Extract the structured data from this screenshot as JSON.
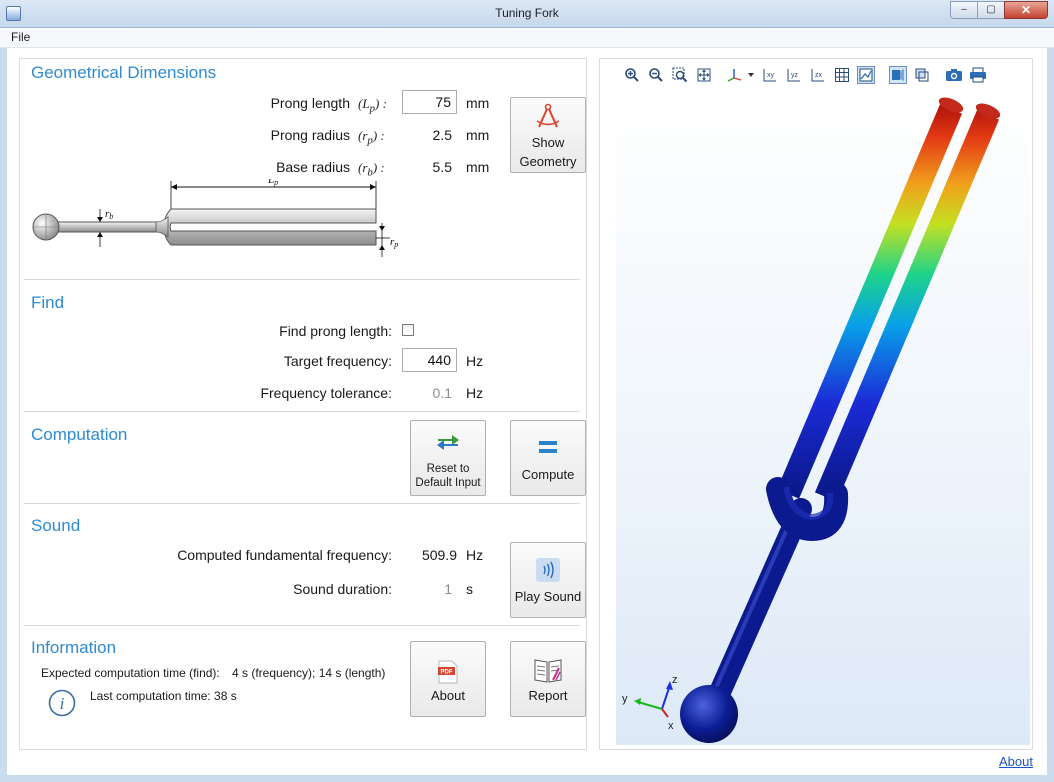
{
  "window": {
    "title": "Tuning Fork"
  },
  "window_controls": {
    "minimize": "–",
    "maximize": "▢",
    "close": "✕"
  },
  "menu": {
    "file": "File"
  },
  "geometry": {
    "title": "Geometrical Dimensions",
    "prong_length": {
      "label": "Prong length",
      "symbol": "(L",
      "sub": "p",
      "close": ") :",
      "value": "75",
      "unit": "mm"
    },
    "prong_radius": {
      "label": "Prong radius",
      "symbol": "(r",
      "sub": "p",
      "close": ") :",
      "value": "2.5",
      "unit": "mm"
    },
    "base_radius": {
      "label": "Base radius",
      "symbol": "(r",
      "sub": "b",
      "close": ") :",
      "value": "5.5",
      "unit": "mm"
    },
    "show_button": {
      "line1": "Show",
      "line2": "Geometry"
    },
    "sketch": {
      "lp": "L",
      "lp_sub": "p",
      "rb": "r",
      "rb_sub": "b",
      "rp": "r",
      "rp_sub": "p"
    }
  },
  "find": {
    "title": "Find",
    "find_prong_length": {
      "label": "Find prong length:",
      "checked": false
    },
    "target_frequency": {
      "label": "Target frequency:",
      "value": "440",
      "unit": "Hz"
    },
    "frequency_tolerance": {
      "label": "Frequency tolerance:",
      "value": "0.1",
      "unit": "Hz"
    }
  },
  "computation": {
    "title": "Computation",
    "reset_button": {
      "line1": "Reset to",
      "line2": "Default Input"
    },
    "compute_button": {
      "label": "Compute"
    }
  },
  "sound": {
    "title": "Sound",
    "fundamental": {
      "label": "Computed fundamental frequency:",
      "value": "509.9",
      "unit": "Hz"
    },
    "duration": {
      "label": "Sound duration:",
      "value": "1",
      "unit": "s"
    },
    "play_button": {
      "label": "Play Sound"
    }
  },
  "information": {
    "title": "Information",
    "expected_label": "Expected computation time (find):",
    "expected_value": "4 s (frequency); 14 s (length)",
    "last_label": "Last computation time: 38 s",
    "about_button": {
      "label": "About",
      "icon_text": "PDF"
    },
    "report_button": {
      "label": "Report"
    }
  },
  "graphics": {
    "axes": {
      "x": "x",
      "y": "y",
      "z": "z"
    },
    "toolbar_icons": [
      "zoom-in-icon",
      "zoom-out-icon",
      "zoom-box-icon",
      "zoom-extents-icon",
      "view-axis-icon",
      "xy-view-icon",
      "yz-view-icon",
      "zx-view-icon",
      "grid-icon",
      "scene-light-icon",
      "transparency-icon",
      "wireframe-icon",
      "camera-icon",
      "print-icon"
    ],
    "toolbar_labels": {
      "xy": "xy",
      "yz": "yz",
      "zx": "zx"
    },
    "colors": {
      "accent": "#2f8bd3",
      "fork_base": "#0a1a8c",
      "fork_tip": "#b20000"
    }
  },
  "footer": {
    "about_link": "About"
  }
}
